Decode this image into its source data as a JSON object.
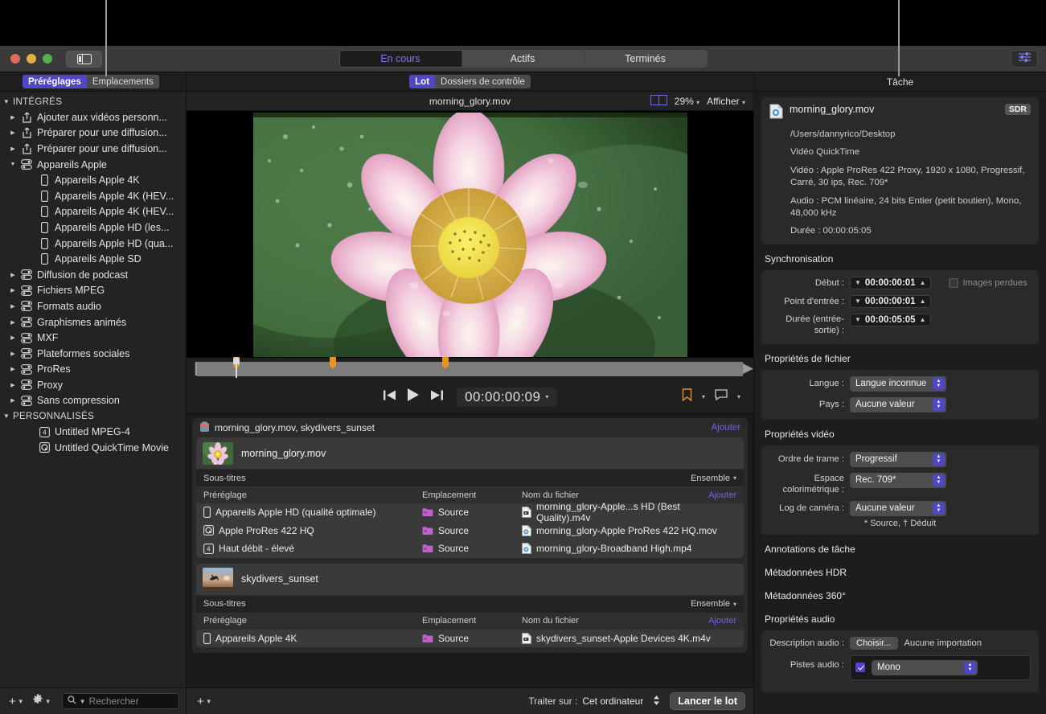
{
  "window": {
    "traffic_lights": [
      "close",
      "minimize",
      "zoom"
    ],
    "tabs": [
      {
        "label": "En cours",
        "active": true
      },
      {
        "label": "Actifs",
        "active": false
      },
      {
        "label": "Terminés",
        "active": false
      }
    ]
  },
  "sidebar": {
    "pills": [
      {
        "label": "Préréglages",
        "active": true
      },
      {
        "label": "Emplacements",
        "active": false
      }
    ],
    "groups": [
      {
        "label": "INTÉGRÉS",
        "expanded": true,
        "items": [
          {
            "label": "Ajouter aux vidéos personn...",
            "icon": "share-icon",
            "level": 1,
            "expandable": true,
            "expanded": false
          },
          {
            "label": "Préparer pour une diffusion...",
            "icon": "share-icon",
            "level": 1,
            "expandable": true,
            "expanded": false
          },
          {
            "label": "Préparer pour une diffusion...",
            "icon": "share-icon",
            "level": 1,
            "expandable": true,
            "expanded": false
          },
          {
            "label": "Appareils Apple",
            "icon": "settings-group-icon",
            "level": 1,
            "expandable": true,
            "expanded": true
          },
          {
            "label": "Appareils Apple 4K",
            "icon": "device-icon",
            "level": 2,
            "expandable": false
          },
          {
            "label": "Appareils Apple 4K (HEV...",
            "icon": "device-icon",
            "level": 2,
            "expandable": false
          },
          {
            "label": "Appareils Apple 4K (HEV...",
            "icon": "device-icon",
            "level": 2,
            "expandable": false
          },
          {
            "label": "Appareils Apple HD (les...",
            "icon": "device-icon",
            "level": 2,
            "expandable": false
          },
          {
            "label": "Appareils Apple HD (qua...",
            "icon": "device-icon",
            "level": 2,
            "expandable": false
          },
          {
            "label": "Appareils Apple SD",
            "icon": "device-icon",
            "level": 2,
            "expandable": false
          },
          {
            "label": "Diffusion de podcast",
            "icon": "settings-group-icon",
            "level": 1,
            "expandable": true,
            "expanded": false
          },
          {
            "label": "Fichiers MPEG",
            "icon": "settings-group-icon",
            "level": 1,
            "expandable": true,
            "expanded": false
          },
          {
            "label": "Formats audio",
            "icon": "settings-group-icon",
            "level": 1,
            "expandable": true,
            "expanded": false
          },
          {
            "label": "Graphismes animés",
            "icon": "settings-group-icon",
            "level": 1,
            "expandable": true,
            "expanded": false
          },
          {
            "label": "MXF",
            "icon": "settings-group-icon",
            "level": 1,
            "expandable": true,
            "expanded": false
          },
          {
            "label": "Plateformes sociales",
            "icon": "settings-group-icon",
            "level": 1,
            "expandable": true,
            "expanded": false
          },
          {
            "label": "ProRes",
            "icon": "settings-group-icon",
            "level": 1,
            "expandable": true,
            "expanded": false
          },
          {
            "label": "Proxy",
            "icon": "settings-group-icon",
            "level": 1,
            "expandable": true,
            "expanded": false
          },
          {
            "label": "Sans compression",
            "icon": "settings-group-icon",
            "level": 1,
            "expandable": true,
            "expanded": false
          }
        ]
      },
      {
        "label": "PERSONNALISÉS",
        "expanded": true,
        "items": [
          {
            "label": "Untitled MPEG-4",
            "icon": "mpeg4-icon",
            "level": 2,
            "expandable": false
          },
          {
            "label": "Untitled QuickTime Movie",
            "icon": "quicktime-icon",
            "level": 2,
            "expandable": false
          }
        ]
      }
    ],
    "footer": {
      "add_label": "+",
      "gear_label": "gear",
      "search_placeholder": "Rechercher",
      "search_value": ""
    }
  },
  "center": {
    "mode_pills": [
      {
        "label": "Lot",
        "active": true
      },
      {
        "label": "Dossiers de contrôle",
        "active": false
      }
    ],
    "preview": {
      "title": "morning_glory.mov",
      "zoom": "29%",
      "view_label": "Afficher"
    },
    "transport": {
      "timecode": "00:00:00:09"
    },
    "batch": {
      "title": "morning_glory.mov, skydivers_sunset",
      "add_label": "Ajouter",
      "jobs": [
        {
          "name": "morning_glory.mov",
          "thumb": "lotus",
          "subtitles_label": "Sous-titres",
          "subtitles_value": "Ensemble",
          "columns": {
            "preset": "Préréglage",
            "location": "Emplacement",
            "filename": "Nom du fichier",
            "add": "Ajouter"
          },
          "outputs": [
            {
              "preset": "Appareils Apple HD (qualité optimale)",
              "preset_icon": "device-icon",
              "location": "Source",
              "filename": "morning_glory-Apple...s HD (Best Quality).m4v",
              "file_icon": "m4v-icon"
            },
            {
              "preset": "Apple ProRes 422 HQ",
              "preset_icon": "quicktime-icon",
              "location": "Source",
              "filename": "morning_glory-Apple ProRes 422 HQ.mov",
              "file_icon": "mov-icon"
            },
            {
              "preset": "Haut débit - élevé",
              "preset_icon": "mpeg4-icon",
              "location": "Source",
              "filename": "morning_glory-Broadband High.mp4",
              "file_icon": "mov-icon"
            }
          ]
        },
        {
          "name": "skydivers_sunset",
          "thumb": "skydive",
          "subtitles_label": "Sous-titres",
          "subtitles_value": "Ensemble",
          "columns": {
            "preset": "Préréglage",
            "location": "Emplacement",
            "filename": "Nom du fichier",
            "add": "Ajouter"
          },
          "outputs": [
            {
              "preset": "Appareils Apple 4K",
              "preset_icon": "device-icon",
              "location": "Source",
              "filename": "skydivers_sunset-Apple Devices 4K.m4v",
              "file_icon": "m4v-icon"
            }
          ]
        }
      ]
    },
    "footer": {
      "add_label": "+",
      "process_label": "Traiter sur :",
      "process_value": "Cet ordinateur",
      "run_label": "Lancer le lot"
    }
  },
  "inspector": {
    "title": "Tâche",
    "file": {
      "name": "morning_glory.mov",
      "badge": "SDR",
      "path": "/Users/dannyrico/Desktop",
      "kind": "Vidéo QuickTime",
      "video": "Vidéo : Apple ProRes 422 Proxy, 1920 x 1080, Progressif, Carré, 30 ips, Rec. 709*",
      "audio": "Audio : PCM linéaire, 24 bits Entier (petit boutien), Mono, 48,000 kHz",
      "duration": "Durée : 00:00:05:05"
    },
    "sync": {
      "title": "Synchronisation",
      "start_label": "Début :",
      "start_value": "00:00:00:01",
      "in_label": "Point d'entrée :",
      "in_value": "00:00:00:01",
      "duration_label": "Durée (entrée-sortie) :",
      "duration_value": "00:00:05:05",
      "dropped_label": "Images perdues",
      "dropped_checked": false
    },
    "file_props": {
      "title": "Propriétés de fichier",
      "language_label": "Langue :",
      "language_value": "Langue inconnue",
      "country_label": "Pays :",
      "country_value": "Aucune valeur"
    },
    "video_props": {
      "title": "Propriétés vidéo",
      "field_order_label": "Ordre de trame :",
      "field_order_value": "Progressif",
      "colorspace_label": "Espace colorimétrique :",
      "colorspace_value": "Rec. 709*",
      "camera_log_label": "Log de caméra :",
      "camera_log_value": "Aucune valeur",
      "note": "* Source, † Déduit"
    },
    "sections": [
      {
        "title": "Annotations de tâche"
      },
      {
        "title": "Métadonnées HDR"
      },
      {
        "title": "Métadonnées 360°"
      }
    ],
    "audio_props": {
      "title": "Propriétés audio",
      "description_label": "Description audio :",
      "choose_label": "Choisir...",
      "description_value": "Aucune importation",
      "tracks_label": "Pistes audio :",
      "track_checked": true,
      "track_value": "Mono"
    }
  },
  "colors": {
    "accent": "#4f46c8",
    "link": "#6d68e0",
    "marker": "#e8921f"
  }
}
